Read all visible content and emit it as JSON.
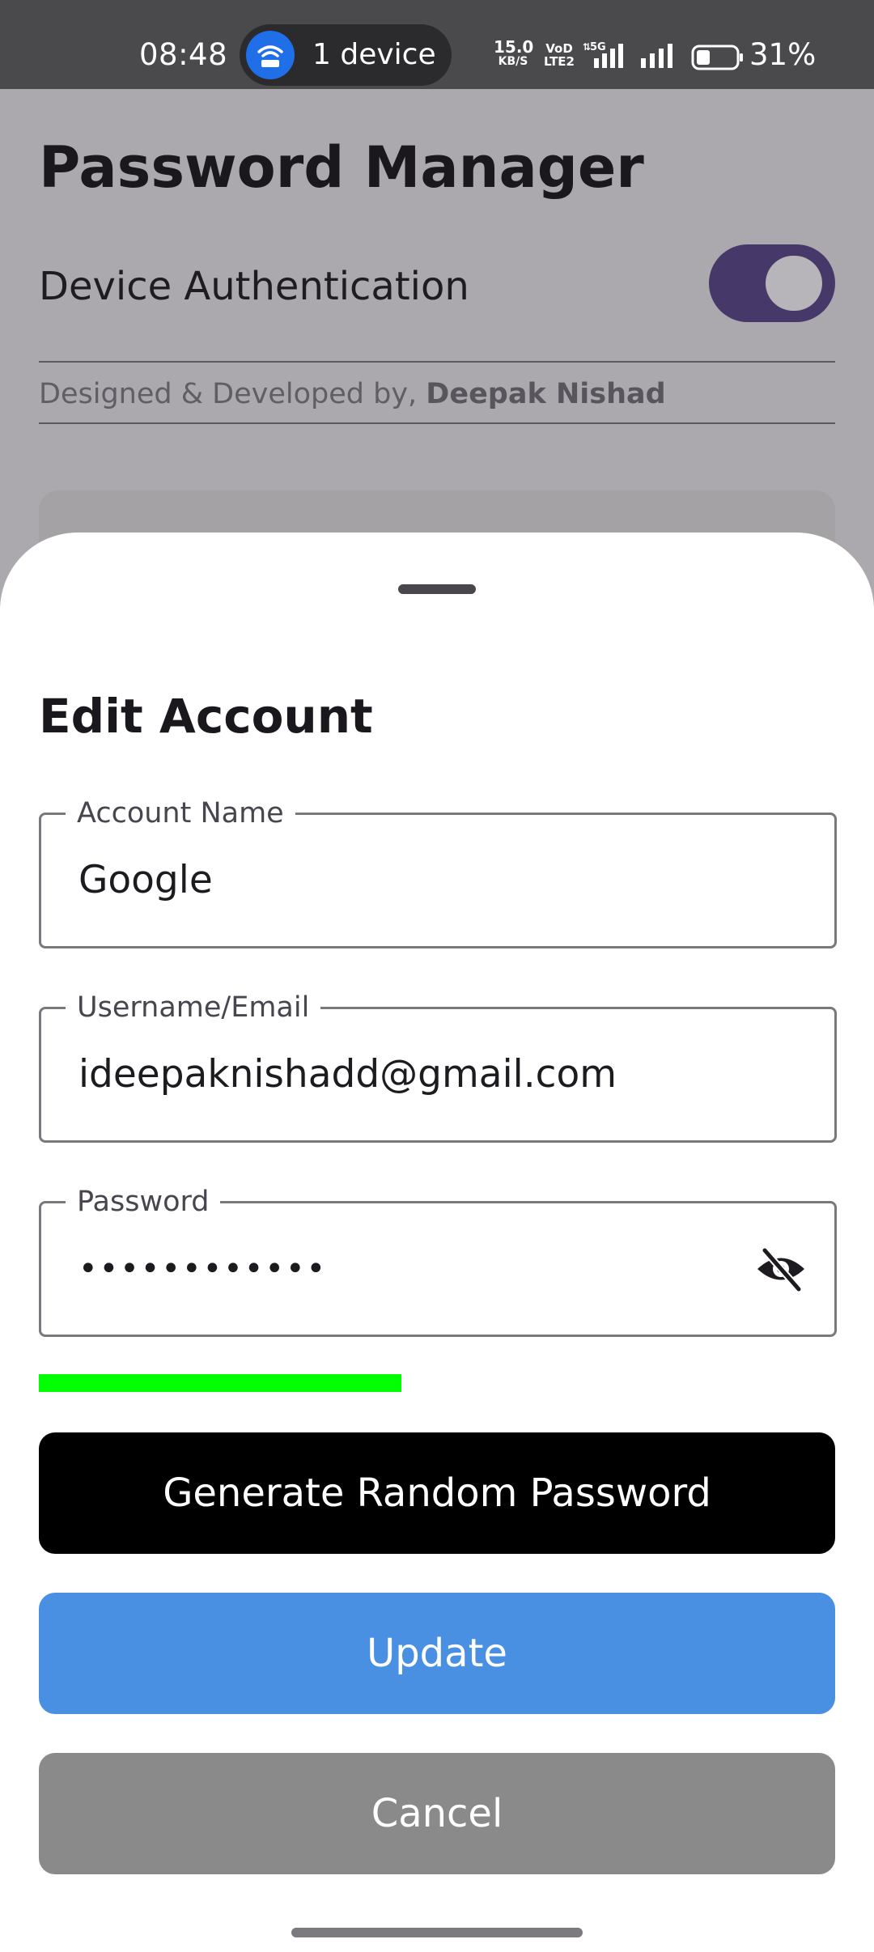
{
  "status_bar": {
    "time": "08:48",
    "hotspot_text": "1 device",
    "hotspot_icon": "wifi-hotspot-icon",
    "net_speed_value": "15.0",
    "net_speed_unit": "KB/S",
    "volte_line1": "VoD",
    "volte_line2": "LTE2",
    "network_type": "5G",
    "battery_percent": "31%"
  },
  "background_page": {
    "title": "Password Manager",
    "setting_label": "Device Authentication",
    "setting_enabled": true,
    "credit_prefix": "Designed & Developed by, ",
    "credit_author": "Deepak Nishad"
  },
  "sheet": {
    "title": "Edit Account",
    "fields": {
      "account_name": {
        "label": "Account Name",
        "value": "Google"
      },
      "username": {
        "label": "Username/Email",
        "value": "ideepaknishadd@gmail.com"
      },
      "password": {
        "label": "Password",
        "value": "••••••••••••",
        "visibility_icon": "eye-off-icon"
      }
    },
    "password_strength": 0.455,
    "buttons": {
      "generate": "Generate Random Password",
      "update": "Update",
      "cancel": "Cancel"
    }
  },
  "colors": {
    "accent_toggle": "#463868",
    "strength_bar": "#00ff00",
    "update_button": "#4a90e2",
    "cancel_button": "#8a8a8a",
    "generate_button": "#000000"
  }
}
